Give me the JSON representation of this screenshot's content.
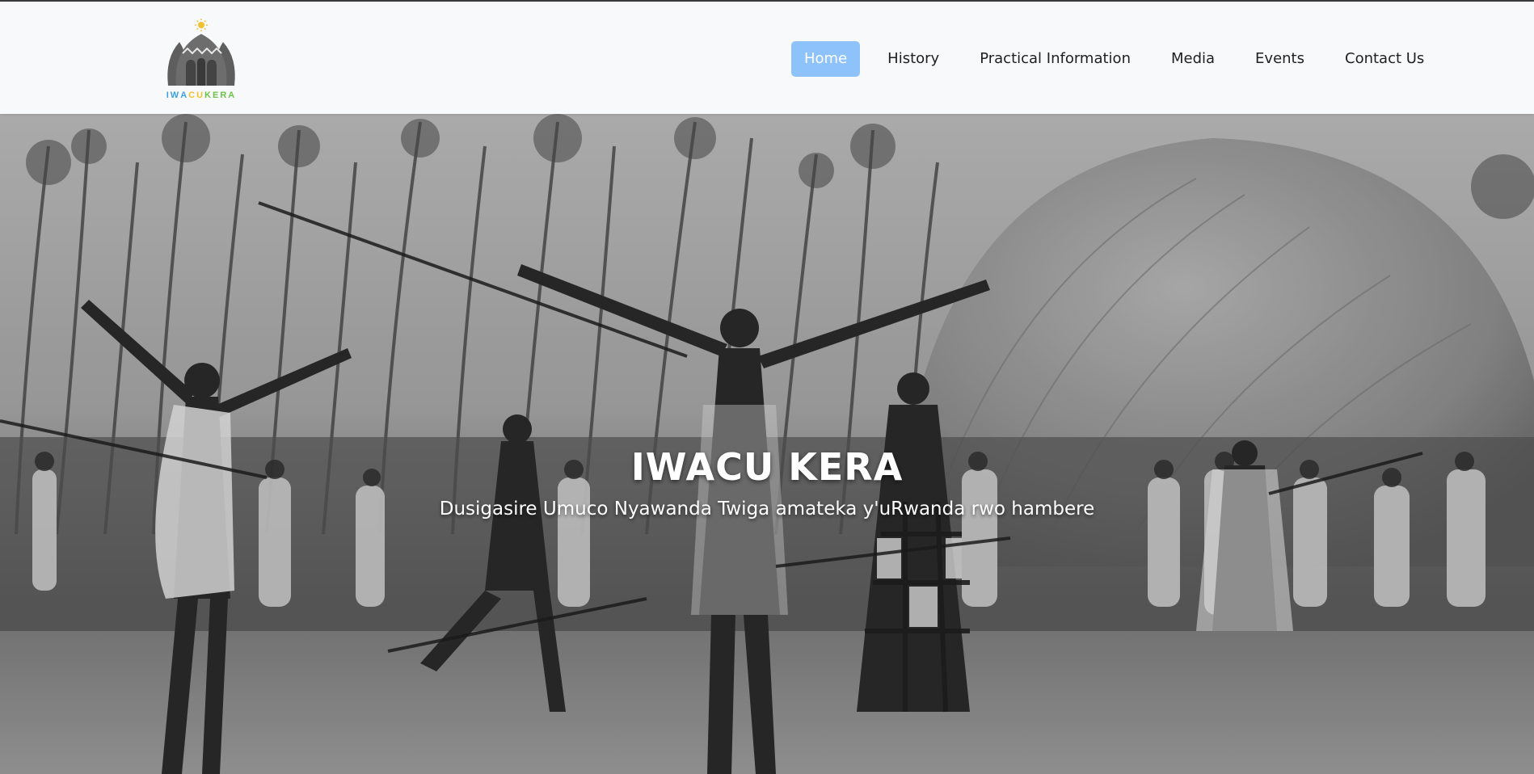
{
  "brand": {
    "logo_letters": [
      {
        "ch": "I",
        "color": "#3aa0e8"
      },
      {
        "ch": "W",
        "color": "#3aa0e8"
      },
      {
        "ch": "A",
        "color": "#3aa0e8"
      },
      {
        "ch": "C",
        "color": "#f2c12e"
      },
      {
        "ch": "U",
        "color": "#f2c12e"
      },
      {
        "ch": "K",
        "color": "#6cc24a"
      },
      {
        "ch": "E",
        "color": "#6cc24a"
      },
      {
        "ch": "R",
        "color": "#6cc24a"
      },
      {
        "ch": "A",
        "color": "#6cc24a"
      }
    ]
  },
  "nav": {
    "items": [
      {
        "label": "Home",
        "active": true
      },
      {
        "label": "History",
        "active": false
      },
      {
        "label": "Practical Information",
        "active": false
      },
      {
        "label": "Media",
        "active": false
      },
      {
        "label": "Events",
        "active": false
      },
      {
        "label": "Contact Us",
        "active": false
      }
    ],
    "active_color": "#8ec2fb"
  },
  "hero": {
    "title": "IWACU KERA",
    "subtitle": "Dusigasire Umuco Nyawanda Twiga amateka y'uRwanda rwo hambere",
    "image_description_icon": "hero-photo"
  }
}
